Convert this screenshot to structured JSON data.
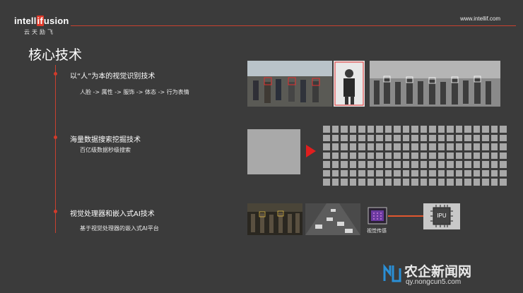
{
  "header": {
    "logo_main": "intell",
    "logo_if": "if",
    "logo_rest": "usion",
    "logo_sub": "云天励飞",
    "website": "www.intellif.com"
  },
  "page": {
    "title": "核心技术"
  },
  "sections": [
    {
      "heading": "以“人”为本的视觉识别技术",
      "sub": "人脸 -> 属性 -> 服饰 -> 体态 -> 行为表情"
    },
    {
      "heading": "海量数据搜索挖掘技术",
      "sub": "百亿级数据秒级搜索"
    },
    {
      "heading": "视觉处理器和嵌入式AI技术",
      "sub": "基于视觉处理器的嵌入式AI平台"
    }
  ],
  "diagram": {
    "chip_left_label": "视觉传感",
    "chip_right_label": "IPU"
  },
  "watermark": {
    "brand": "农企新闻网",
    "url": "qy.nongcun5.com"
  },
  "colors": {
    "background": "#3b3b3b",
    "accent": "#c8412f",
    "arrow": "#e01e1e"
  }
}
